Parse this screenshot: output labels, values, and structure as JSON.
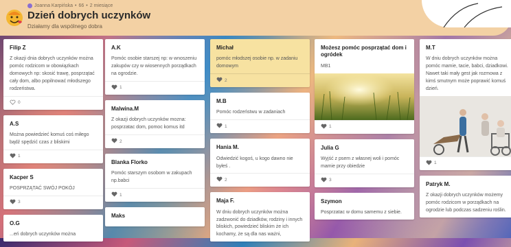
{
  "header": {
    "author": "Joanna Karpińska",
    "points": "66",
    "time": "2 miesiące",
    "title": "Dzień dobrych uczynków",
    "subtitle": "Działamy dla wspólnego dobra"
  },
  "columns": [
    [
      {
        "title": "Filip Z",
        "text": "Z okazji dnia dobrych uczynków można pomóc rodzicom w obowiązkach domowych np: skosić trawę, posprzątać cały dom, albo popilnować młodszego rodzeństwa.",
        "likes": "0"
      },
      {
        "title": "A.S",
        "text": "Można powiedzieć komuś coś miłego bądź spędzić czas z bliskimi",
        "likes": "1"
      },
      {
        "title": "Kacper S",
        "text": "POSPRZĄTAĆ SWÓJ POKÓJ",
        "likes": "3"
      },
      {
        "title": "O.G",
        "text": "...eń dobrych uczynków można",
        "likes": ""
      }
    ],
    [
      {
        "title": "A.K",
        "text": "Pomóc osobie starszej np: w wnoszeniu zakupów czy w wiosennych porządkach na ogrodzie.",
        "likes": "1"
      },
      {
        "title": "Malwina.M",
        "text": "Z okazji dobrych uczynków mozna: posprzatac dom, pomoc komus itd",
        "likes": "2"
      },
      {
        "title": "Blanka Florko",
        "text": "Pomóc starszym osobom w zakupach np.babci",
        "likes": "1"
      },
      {
        "title": "Maks",
        "text": "",
        "likes": ""
      }
    ],
    [
      {
        "title": "Michał",
        "text": "pomóc młodszej osobie np. w zadaniu domowym",
        "likes": "2",
        "yellow": true
      },
      {
        "title": "M.B",
        "text": "Pomóc rodzeństwu w zadaniach",
        "likes": "1"
      },
      {
        "title": "Hania M.",
        "text": "Odwiedzić kogoś, u kogo dawno nie byłeś .",
        "likes": "2"
      },
      {
        "title": "Maja F.",
        "text": "W dniu dobrych uczynków można zadzwonić do dziadków, rodziny i innych bliskich, powiedzieć bliskim że ich kochamy, że są dla nas ważni,",
        "likes": ""
      }
    ],
    [
      {
        "title": "Możesz pomóc posprzątać dom i ogródek",
        "text": "MB1",
        "likes": "1",
        "image": "field"
      },
      {
        "title": "Julia G",
        "text": "Wyjść z psem z własnej woli i pomóc mamie przy obiedzie",
        "likes": "3"
      },
      {
        "title": "Szymon",
        "text": "Posprzatac w domu samemu z siebie.",
        "likes": ""
      }
    ],
    [
      {
        "title": "M.T",
        "text": "W dniu dobrych uczynków można pomóc mamie, tacie, babci, dziadkowi. Nawet taki mały gest jak rozmowa z kimś smutnym może poprawić komuś dzień.",
        "likes": "1",
        "image": "people"
      },
      {
        "title": "Patryk M.",
        "text": "Z okazji dobrych uczynków możemy pomóc rodzicom w porządkach na ogrodzie lub podczas sadzeniu roślin.",
        "likes": ""
      }
    ]
  ],
  "colors": {
    "header": "#f3d1a4",
    "highlight": "#f7e2a1"
  }
}
